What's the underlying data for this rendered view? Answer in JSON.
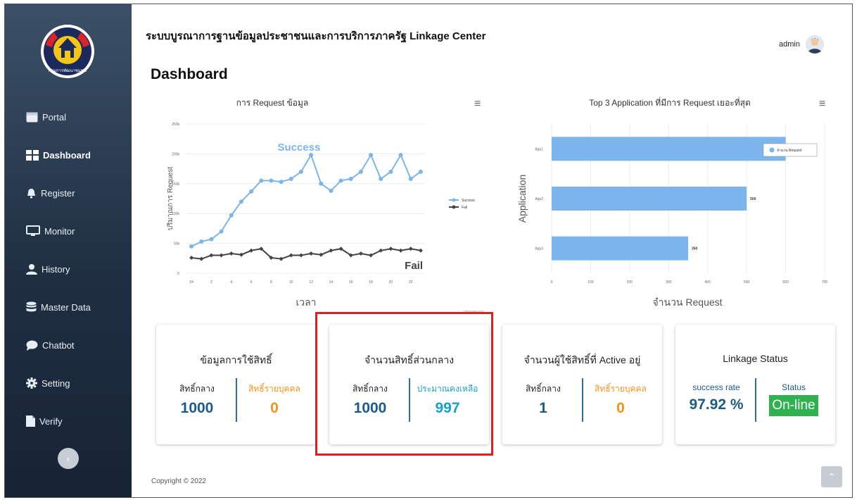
{
  "app": {
    "title": "ระบบบูรณาการฐานข้อมูลประชาชนและการบริการภาครัฐ Linkage Center",
    "page_title": "Dashboard",
    "user": "admin",
    "logo_text": "กรมการพัฒนาชุมชน"
  },
  "sidebar": {
    "items": [
      {
        "label": "Portal",
        "icon": "portal-icon"
      },
      {
        "label": "Dashboard",
        "icon": "dashboard-icon",
        "active": true
      },
      {
        "label": "Register",
        "icon": "bell-icon"
      },
      {
        "label": "Monitor",
        "icon": "monitor-icon"
      },
      {
        "label": "History",
        "icon": "user-icon"
      },
      {
        "label": "Master Data",
        "icon": "database-icon"
      },
      {
        "label": "Chatbot",
        "icon": "chat-icon"
      },
      {
        "label": "Setting",
        "icon": "gear-icon"
      },
      {
        "label": "Verify",
        "icon": "file-icon"
      }
    ],
    "collapse_label": "‹"
  },
  "chart_data": [
    {
      "type": "line",
      "title": "การ Request ข้อมูล",
      "xlabel": "เวลา",
      "ylabel": "ปริมาณการ Request",
      "ylim": [
        0,
        250000
      ],
      "yticks": [
        "0",
        "50k",
        "100k",
        "150k",
        "200k",
        "250k"
      ],
      "x": [
        "24",
        "1",
        "2",
        "3",
        "4",
        "5",
        "6",
        "7",
        "8",
        "9",
        "10",
        "11",
        "12",
        "13",
        "14",
        "15",
        "16",
        "17",
        "18",
        "19",
        "20",
        "21",
        "22",
        "23"
      ],
      "xticks": [
        "24",
        "2",
        "4",
        "6",
        "8",
        "10",
        "12",
        "14",
        "16",
        "18",
        "20",
        "22"
      ],
      "series": [
        {
          "name": "Success",
          "color": "#7cb5ec",
          "values": [
            45000,
            53000,
            57000,
            70000,
            97000,
            120000,
            137000,
            155000,
            155000,
            153000,
            158000,
            170000,
            198000,
            150000,
            138000,
            155000,
            158000,
            170000,
            198000,
            158000,
            170000,
            198000,
            158000,
            170000
          ]
        },
        {
          "name": "Fail",
          "color": "#434348",
          "values": [
            26000,
            24000,
            30000,
            30000,
            33000,
            31000,
            38000,
            41000,
            26000,
            24000,
            30000,
            30000,
            33000,
            31000,
            38000,
            41000,
            30000,
            33000,
            30000,
            38000,
            41000,
            38000,
            41000,
            38000
          ]
        }
      ],
      "annotations": [
        "Success",
        "Fail"
      ],
      "credit": "Highcharts.com",
      "legend": "right"
    },
    {
      "type": "bar",
      "orientation": "horizontal",
      "title": "Top 3 Application ที่มีการ Request เยอะที่สุด",
      "xlabel": "จำนวน Request",
      "ylabel": "Application",
      "categories": [
        "App1",
        "App2",
        "App3"
      ],
      "values": [
        600,
        500,
        350
      ],
      "data_labels": [
        "",
        "500",
        "350"
      ],
      "xlim": [
        0,
        700
      ],
      "xticks": [
        "0",
        "100",
        "200",
        "300",
        "400",
        "500",
        "600",
        "700"
      ],
      "series_name": "จำนวน Request",
      "color": "#7cb5ec",
      "legend": "top-right"
    }
  ],
  "cards": [
    {
      "title": "ข้อมูลการใช้สิทธิ์",
      "left_label": "สิทธิ์กลาง",
      "left_value": "1000",
      "right_label": "สิทธิ์รายบุคคล",
      "right_value": "0"
    },
    {
      "title": "จำนวนสิทธิ์ส่วนกลาง",
      "left_label": "สิทธิ์กลาง",
      "left_value": "1000",
      "right_label": "ประมาณคงเหลือ",
      "right_value": "997"
    },
    {
      "title": "จำนวนผู้ใช้สิทธิ์ที่ Active อยู่",
      "left_label": "สิทธิ์กลาง",
      "left_value": "1",
      "right_label": "สิทธิ์รายบุคคล",
      "right_value": "0"
    },
    {
      "title": "Linkage Status",
      "left_label": "success rate",
      "left_value": "97.92 %",
      "right_label": "Status",
      "right_value": "On-line"
    }
  ],
  "colors": {
    "sidebar_top": "#3b5068",
    "sidebar_bottom": "#162335",
    "accent_blue": "#1c75bc",
    "orange": "#f0941e",
    "online_green": "#2fb14f",
    "highlight_red": "#e02020"
  },
  "footer": {
    "copyright": "Copyright © 2022",
    "scroll_top": "⌃"
  }
}
